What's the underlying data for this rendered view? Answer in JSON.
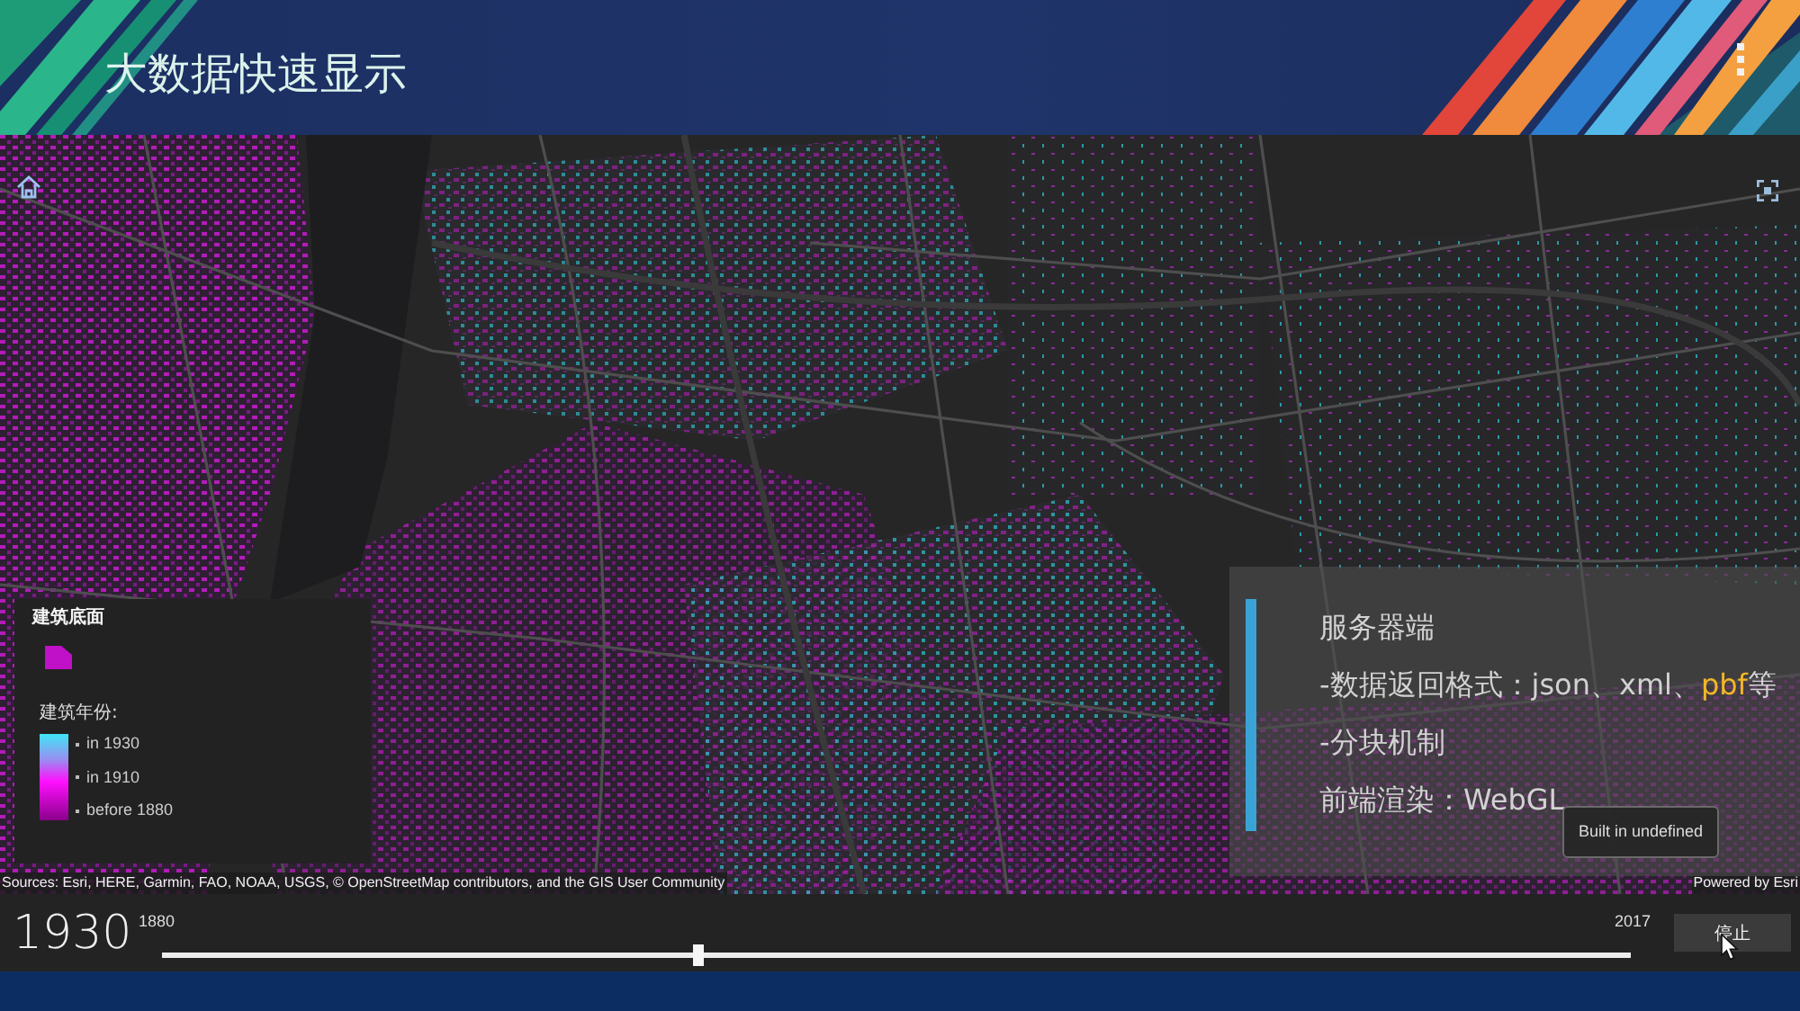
{
  "header": {
    "title": "大数据快速显示"
  },
  "map": {
    "legend": {
      "layer_title": "建筑底面",
      "field_title": "建筑年份:",
      "stops": [
        {
          "label": "in 1930"
        },
        {
          "label": "in 1910"
        },
        {
          "label": "before 1880"
        }
      ]
    },
    "info_panel": {
      "lines": [
        {
          "segments": [
            {
              "text": "服务器端",
              "highlight": false
            }
          ]
        },
        {
          "segments": [
            {
              "text": "-数据返回格式：json、xml、",
              "highlight": false
            },
            {
              "text": "pbf",
              "highlight": true
            },
            {
              "text": "等",
              "highlight": false
            }
          ]
        },
        {
          "segments": [
            {
              "text": "-分块机制",
              "highlight": false
            }
          ]
        },
        {
          "segments": [
            {
              "text": "前端渲染：WebGL",
              "highlight": false
            }
          ]
        }
      ]
    },
    "tooltip": "Built in undefined",
    "attribution": "Sources: Esri, HERE, Garmin, FAO, NOAA, USGS, © OpenStreetMap contributors, and the GIS User Community",
    "powered_by": "Powered by Esri"
  },
  "timeline": {
    "current_year": "1930",
    "min_label": "1880",
    "max_label": "2017",
    "level": 0.365,
    "button": "停止"
  }
}
